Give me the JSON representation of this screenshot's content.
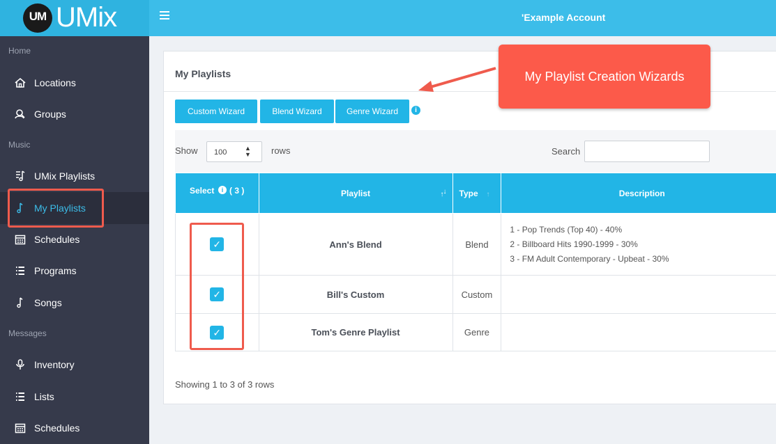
{
  "header": {
    "logo_badge": "UM",
    "logo_text": "UMix",
    "account": "'Example Account"
  },
  "sidebar": {
    "sections": [
      "Home",
      "Music",
      "Messages"
    ],
    "items": [
      {
        "label": "Locations",
        "icon": "home-icon"
      },
      {
        "label": "Groups",
        "icon": "user-icon"
      },
      {
        "label": "UMix Playlists",
        "icon": "music-list-icon"
      },
      {
        "label": "My Playlists",
        "icon": "music-note-icon",
        "active": true
      },
      {
        "label": "Schedules",
        "icon": "calendar-icon"
      },
      {
        "label": "Programs",
        "icon": "list-icon"
      },
      {
        "label": "Songs",
        "icon": "music-note-icon"
      },
      {
        "label": "Inventory",
        "icon": "microphone-icon"
      },
      {
        "label": "Lists",
        "icon": "list-icon"
      },
      {
        "label": "Schedules",
        "icon": "calendar-icon"
      }
    ]
  },
  "main": {
    "title": "My Playlists",
    "wizards": [
      "Custom Wizard",
      "Blend Wizard",
      "Genre Wizard"
    ],
    "info_glyph": "i",
    "show_label": "Show",
    "rows_value": "100",
    "rows_label": "rows",
    "search_label": "Search",
    "search_value": "",
    "table": {
      "headers": {
        "select": "Select",
        "select_count": "( 3 )",
        "playlist": "Playlist",
        "type": "Type",
        "description": "Description"
      },
      "rows": [
        {
          "name": "Ann's Blend",
          "type": "Blend",
          "checked": true,
          "desc": [
            "1 - Pop Trends (Top 40) - 40%",
            "2 - Billboard Hits 1990-1999 - 30%",
            "3 - FM Adult Contemporary - Upbeat - 30%"
          ]
        },
        {
          "name": "Bill's Custom",
          "type": "Custom",
          "checked": true,
          "desc": []
        },
        {
          "name": "Tom's Genre Playlist",
          "type": "Genre",
          "checked": true,
          "desc": []
        }
      ]
    },
    "footer": "Showing 1 to 3 of 3 rows"
  },
  "callout": {
    "text": "My Playlist Creation Wizards"
  },
  "colors": {
    "accent": "#22b5e6",
    "header": "#3cbde9",
    "sidebar": "#363a4b",
    "callout": "#fc5a4a",
    "highlight_border": "#ef5b4d"
  }
}
